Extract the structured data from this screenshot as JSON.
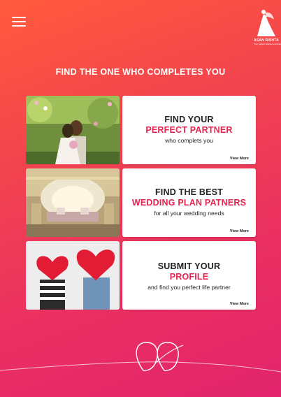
{
  "app": {
    "logo_name": "ASAN RISHTA",
    "logo_tagline": "Your perfect Rishta for all families"
  },
  "headline": "FIND THE ONE WHO COMPLETES YOU",
  "cards": [
    {
      "line1": "FIND YOUR",
      "line2": "PERFECT PARTNER",
      "line3": "who complets you",
      "more": "View More"
    },
    {
      "line1": "FIND THE BEST",
      "line2": "WEDDING PLAN PATNERS",
      "line3": "for all your wedding needs",
      "more": "View More"
    },
    {
      "line1": "SUBMIT YOUR",
      "line2": "PROFILE",
      "line3": "and  find you perfect life partner",
      "more": "View More"
    }
  ],
  "colors": {
    "accent": "#e6244f",
    "bg_start": "#ff5a3c",
    "bg_end": "#e1246b"
  },
  "icons": {
    "menu": "menu-icon",
    "logo": "bride-logo-icon",
    "decor": "hearts-decoration-icon"
  }
}
